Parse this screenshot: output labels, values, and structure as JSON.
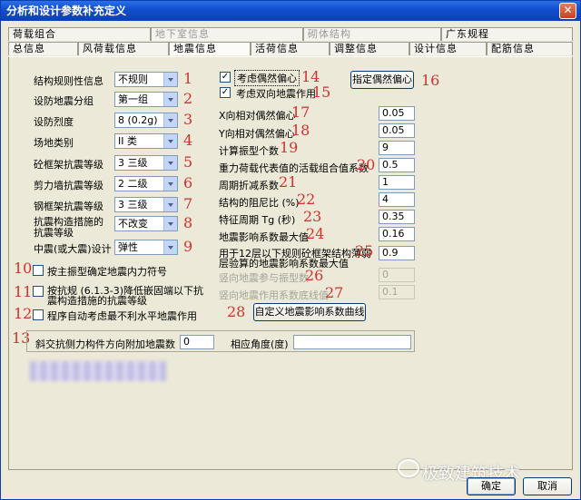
{
  "window": {
    "title": "分析和设计参数补充定义",
    "close_glyph": "✕"
  },
  "tabs_row1": [
    {
      "label": "荷载组合",
      "disabled": false
    },
    {
      "label": "地下室信息",
      "disabled": true
    },
    {
      "label": "砌体结构",
      "disabled": true
    },
    {
      "label": "广东规程",
      "disabled": false
    }
  ],
  "tabs_row2": [
    {
      "label": "总信息"
    },
    {
      "label": "风荷载信息"
    },
    {
      "label": "地震信息"
    },
    {
      "label": "活荷信息"
    },
    {
      "label": "调整信息"
    },
    {
      "label": "设计信息"
    },
    {
      "label": "配筋信息"
    }
  ],
  "left": {
    "rows": [
      {
        "label": "结构规则性信息",
        "value": "不规则",
        "num": "1"
      },
      {
        "label": "设防地震分组",
        "value": "第一组",
        "num": "2"
      },
      {
        "label": "设防烈度",
        "value": "8 (0.2g)",
        "num": "3"
      },
      {
        "label": "场地类别",
        "value": "II 类",
        "num": "4"
      },
      {
        "label": "砼框架抗震等级",
        "value": "3  三级",
        "num": "5"
      },
      {
        "label": "剪力墙抗震等级",
        "value": "2  二级",
        "num": "6"
      },
      {
        "label": "钢框架抗震等级",
        "value": "3  三级",
        "num": "7"
      },
      {
        "label": "抗震构造措施的",
        "label2": "抗震等级",
        "value": "不改变",
        "num": "8"
      },
      {
        "label": "中震(或大震)设计",
        "value": "弹性",
        "num": "9"
      }
    ],
    "checks": [
      {
        "num": "10",
        "label": "按主振型确定地震内力符号",
        "checked": false
      },
      {
        "num": "11",
        "label": "按抗规 (6.1.3-3)降低嵌固端以下抗",
        "label2": "震构造措施的抗震等级",
        "checked": false
      },
      {
        "num": "12",
        "label": "程序自动考虑最不利水平地震作用",
        "checked": false
      }
    ]
  },
  "right": {
    "check14": {
      "label": "考虑偶然偏心",
      "checked": true,
      "num": "14"
    },
    "check15": {
      "label": "考虑双向地震作用",
      "checked": true,
      "num": "15"
    },
    "btn16": {
      "label": "指定偶然偏心",
      "num": "16"
    },
    "rows": [
      {
        "label": "X向相对偶然偏心",
        "value": "0.05",
        "num": "17",
        "disabled": false
      },
      {
        "label": "Y向相对偶然偏心",
        "value": "0.05",
        "num": "18",
        "disabled": false
      },
      {
        "label": "计算振型个数",
        "value": "9",
        "num": "19",
        "disabled": false
      },
      {
        "label": "重力荷载代表值的活载组合值系数",
        "value": "0.5",
        "num": "20",
        "disabled": false
      },
      {
        "label": "周期折减系数",
        "value": "1",
        "num": "21",
        "disabled": false
      },
      {
        "label": "结构的阻尼比 (%)",
        "value": "4",
        "num": "22",
        "disabled": false
      },
      {
        "label": "特征周期 Tg (秒)",
        "value": "0.35",
        "num": "23",
        "disabled": false
      },
      {
        "label": "地震影响系数最大值",
        "value": "0.16",
        "num": "24",
        "disabled": false
      },
      {
        "label": "用于12层以下规则砼框架结构薄弱",
        "label2": "层验算的地震影响系数最大值",
        "value": "0.9",
        "num": "25",
        "disabled": false
      },
      {
        "label": "竖向地震参与振型数",
        "value": "0",
        "num": "26",
        "disabled": true
      },
      {
        "label": "竖向地震作用系数底线值",
        "value": "0.1",
        "num": "27",
        "disabled": true
      }
    ],
    "btn28": {
      "label": "自定义地震影响系数曲线",
      "num": "28"
    }
  },
  "group13": {
    "num": "13",
    "label": "斜交抗侧力构件方向附加地震数",
    "value": "0",
    "angle_label": "相应角度(度)",
    "angle_value": ""
  },
  "footer": {
    "ok": "确定",
    "cancel": "取消",
    "watermark": "极致建筑技术"
  }
}
